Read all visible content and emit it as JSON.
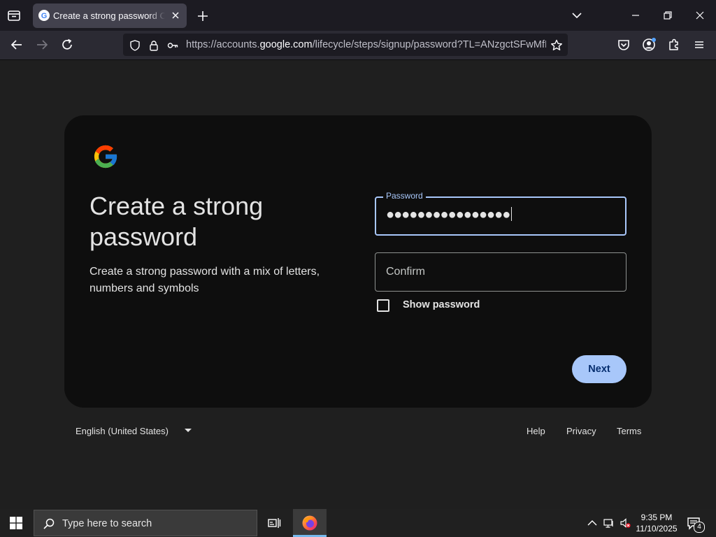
{
  "browser": {
    "tab_title": "Create a strong password Create a strong password",
    "url_prefix": "https://accounts.",
    "url_domain": "google.com",
    "url_path": "/lifecycle/steps/signup/password?TL=ANzgctSFwMfKEN"
  },
  "page": {
    "heading": "Create a strong password",
    "subheading": "Create a strong password with a mix of letters, numbers and symbols",
    "password_label": "Password",
    "password_dots": "●●●●●●●●●●●●●●●●",
    "confirm_placeholder": "Confirm",
    "show_password_label": "Show password",
    "show_password_checked": false,
    "next_label": "Next"
  },
  "footer": {
    "language": "English (United States)",
    "links": [
      "Help",
      "Privacy",
      "Terms"
    ]
  },
  "taskbar": {
    "search_placeholder": "Type here to search",
    "time": "9:35 PM",
    "date": "11/10/2025",
    "notification_count": "4"
  },
  "colors": {
    "accent": "#a8c7fa",
    "card_bg": "#0e0e0e",
    "page_bg": "#1f1f1f"
  }
}
